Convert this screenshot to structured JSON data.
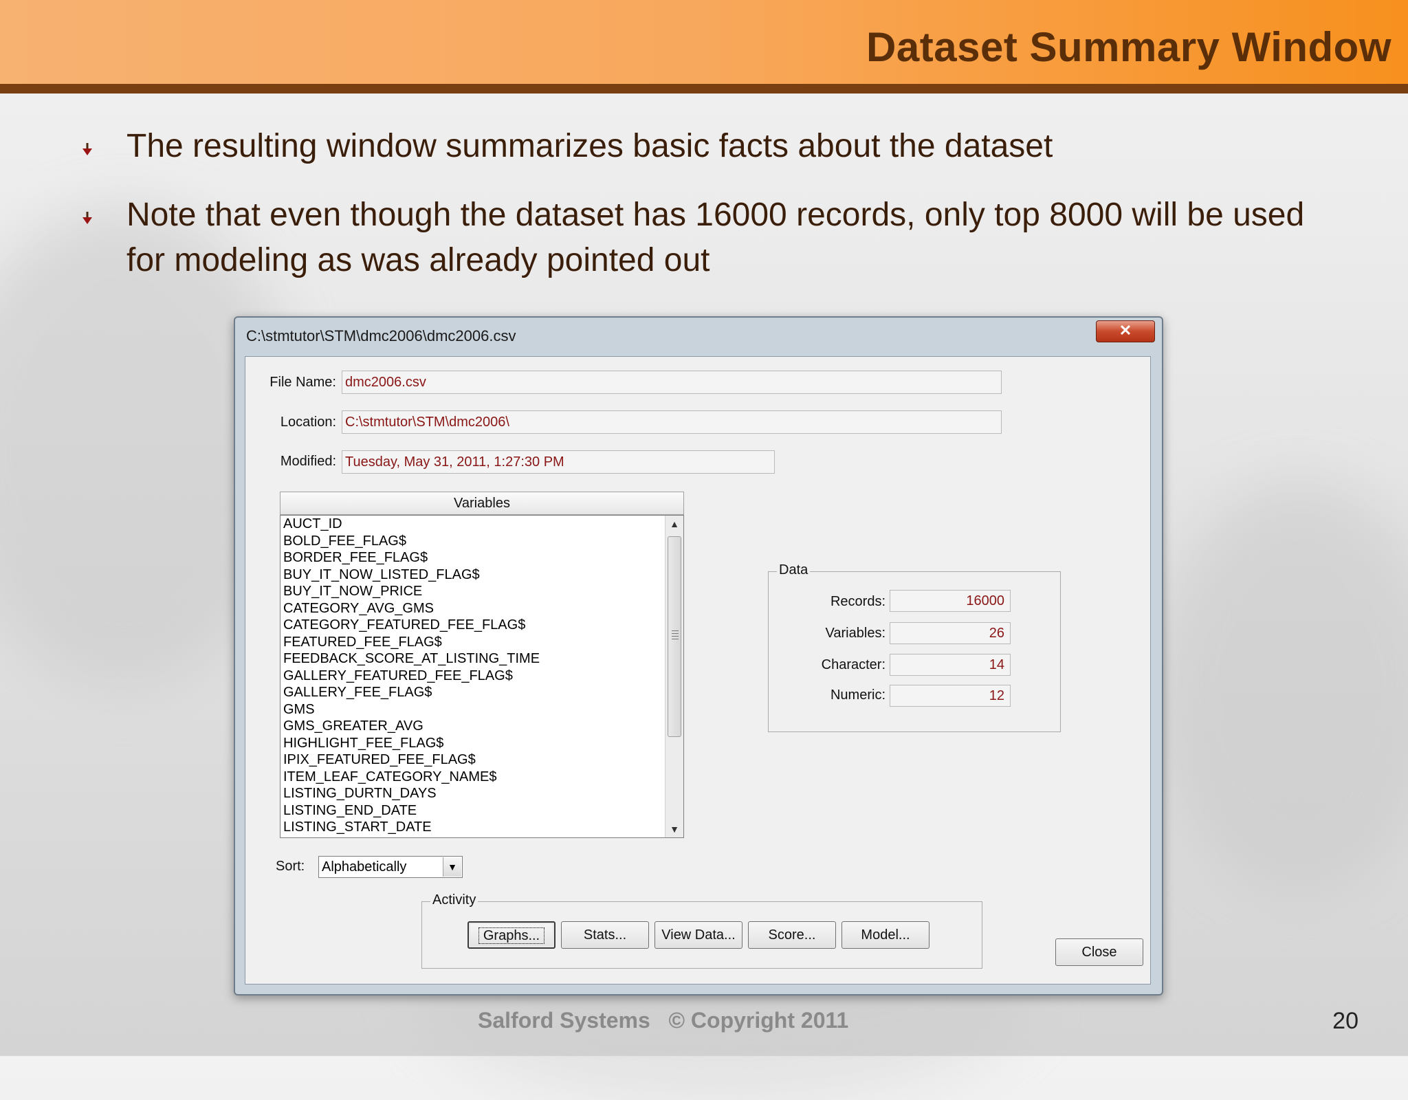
{
  "slide": {
    "title": "Dataset Summary Window",
    "bullets": [
      "The resulting window summarizes basic facts about the dataset",
      "Note that even though the dataset has 16000 records, only top 8000 will be used for modeling as was already pointed out"
    ],
    "footer": "Salford Systems   © Copyright 2011",
    "page_number": "20"
  },
  "window": {
    "title": "C:\\stmtutor\\STM\\dmc2006\\dmc2006.csv",
    "close_glyph": "✕",
    "file_name_label": "File Name:",
    "file_name": "dmc2006.csv",
    "location_label": "Location:",
    "location": "C:\\stmtutor\\STM\\dmc2006\\",
    "modified_label": "Modified:",
    "modified": "Tuesday, May 31, 2011, 1:27:30 PM",
    "variables_header": "Variables",
    "variables": [
      "AUCT_ID",
      "BOLD_FEE_FLAG$",
      "BORDER_FEE_FLAG$",
      "BUY_IT_NOW_LISTED_FLAG$",
      "BUY_IT_NOW_PRICE",
      "CATEGORY_AVG_GMS",
      "CATEGORY_FEATURED_FEE_FLAG$",
      "FEATURED_FEE_FLAG$",
      "FEEDBACK_SCORE_AT_LISTING_TIME",
      "GALLERY_FEATURED_FEE_FLAG$",
      "GALLERY_FEE_FLAG$",
      "GMS",
      "GMS_GREATER_AVG",
      "HIGHLIGHT_FEE_FLAG$",
      "IPIX_FEATURED_FEE_FLAG$",
      "ITEM_LEAF_CATEGORY_NAME$",
      "LISTING_DURTN_DAYS",
      "LISTING_END_DATE",
      "LISTING_START_DATE"
    ],
    "data_group": {
      "title": "Data",
      "records_label": "Records:",
      "records": "16000",
      "variables_label": "Variables:",
      "variables": "26",
      "character_label": "Character:",
      "character": "14",
      "numeric_label": "Numeric:",
      "numeric": "12"
    },
    "sort_label": "Sort:",
    "sort_value": "Alphabetically",
    "activity_group": {
      "title": "Activity",
      "buttons": [
        "Graphs...",
        "Stats...",
        "View Data...",
        "Score...",
        "Model..."
      ]
    },
    "close_button": "Close"
  }
}
